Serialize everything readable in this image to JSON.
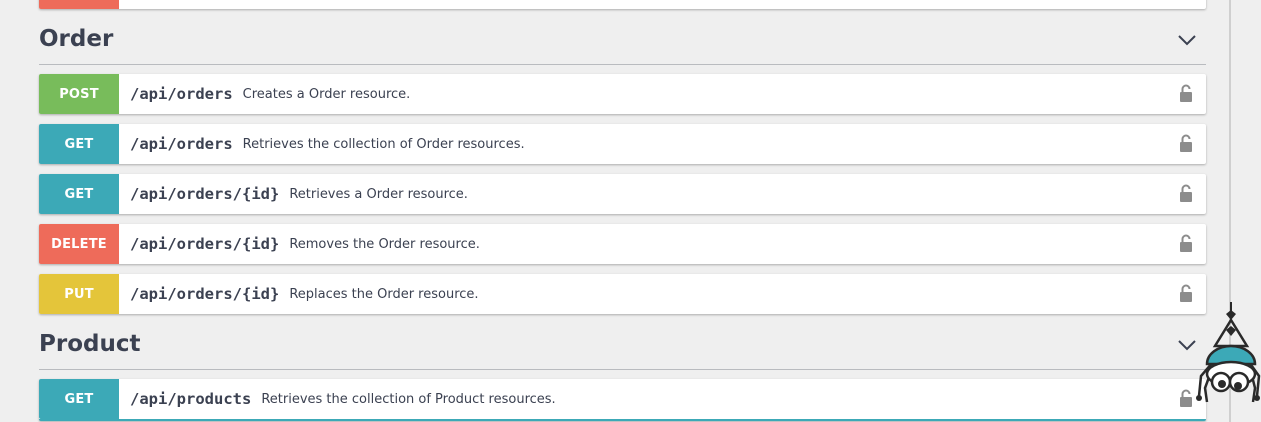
{
  "colors": {
    "post": "#78bc5b",
    "get": "#3ca9b7",
    "delete": "#ee6b5a",
    "put": "#e4c53a"
  },
  "icons": {
    "lock": "lock-icon",
    "chevron": "chevron-down-icon",
    "mascot": "spider-mascot"
  },
  "groups": [
    {
      "name": "Order",
      "operations": [
        {
          "method": "POST",
          "path": "/api/orders",
          "summary": "Creates a Order resource."
        },
        {
          "method": "GET",
          "path": "/api/orders",
          "summary": "Retrieves the collection of Order resources."
        },
        {
          "method": "GET",
          "path": "/api/orders/{id}",
          "summary": "Retrieves a Order resource."
        },
        {
          "method": "DELETE",
          "path": "/api/orders/{id}",
          "summary": "Removes the Order resource."
        },
        {
          "method": "PUT",
          "path": "/api/orders/{id}",
          "summary": "Replaces the Order resource."
        }
      ]
    },
    {
      "name": "Product",
      "operations": [
        {
          "method": "GET",
          "path": "/api/products",
          "summary": "Retrieves the collection of Product resources."
        }
      ]
    }
  ]
}
